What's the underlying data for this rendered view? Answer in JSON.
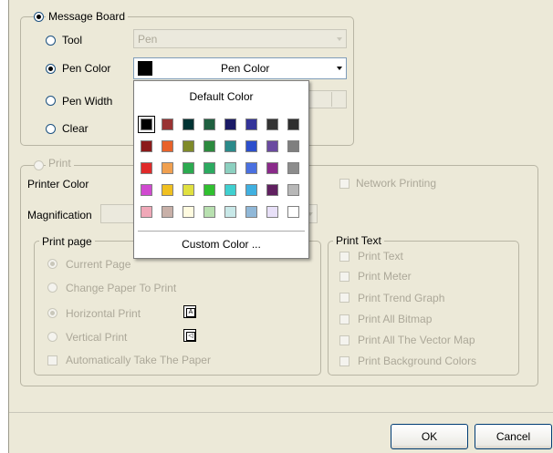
{
  "message_board": {
    "label": "Message Board",
    "tool_label": "Tool",
    "tool_value": "Pen",
    "pen_color_label": "Pen Color",
    "pen_color_value": "Pen Color",
    "pen_width_label": "Pen Width",
    "clear_label": "Clear"
  },
  "color_popup": {
    "default_label": "Default Color",
    "custom_label": "Custom Color ...",
    "swatches": [
      [
        "#000000",
        "#993333",
        "#003333",
        "#336633",
        "#000080",
        "#333399",
        "#333333"
      ],
      [
        "#800000",
        "#ff6600",
        "#808000",
        "#008000",
        "#008080",
        "#0000ff",
        "#666699",
        "#808080"
      ],
      [
        "#ff0000",
        "#ff9900",
        "#99cc00",
        "#339966",
        "#33cccc",
        "#3366ff",
        "#800080",
        "#999999"
      ],
      [
        "#ff00ff",
        "#ffcc00",
        "#ffff00",
        "#00ff00",
        "#00ffff",
        "#00ccff",
        "#993366",
        "#c0c0c0"
      ],
      [
        "#ff99cc",
        "#ffcc99",
        "#ffff99",
        "#ccffcc",
        "#ccffff",
        "#99ccff",
        "#cc99ff",
        "#ffffff"
      ]
    ],
    "colors": {
      "r0": [
        "#000000",
        "#993333",
        "#003333",
        "#1f6040",
        "#1a1a66",
        "#333399",
        "#333333",
        "#2e2e2e"
      ],
      "r1": [
        "#8b1a1a",
        "#e8622a",
        "#7f8a2a",
        "#2c8a3e",
        "#2b8a8a",
        "#2c4ecc",
        "#6a4aa0",
        "#7f7f7f"
      ],
      "r2": [
        "#e02a2a",
        "#f0a050",
        "#2caa50",
        "#2caa60",
        "#8cd0c0",
        "#4a70e0",
        "#8a2a8a",
        "#8c8c8c"
      ],
      "r3": [
        "#d04ad0",
        "#f0c020",
        "#e0e040",
        "#30c030",
        "#40d0d0",
        "#40b0e0",
        "#602060",
        "#b8b8b8"
      ],
      "r4": [
        "#f0a8b8",
        "#c8b0a8",
        "#fffbe0",
        "#b8e0b0",
        "#c8e8e8",
        "#90b8d8",
        "#e8e0f8",
        "#ffffff"
      ]
    }
  },
  "print": {
    "label": "Print",
    "printer_color_label": "Printer Color",
    "magnification_label": "Magnification",
    "network_printing_label": "Network Printing"
  },
  "print_page": {
    "label": "Print page",
    "current_page": "Current Page",
    "change_paper": "Change Paper To Print",
    "horizontal": "Horizontal Print",
    "vertical": "Vertical Print",
    "auto_take": "Automatically Take The Paper"
  },
  "print_text": {
    "label": "Print Text",
    "items": [
      "Print Text",
      "Print Meter",
      "Print Trend Graph",
      "Print All Bitmap",
      "Print All The Vector Map",
      "Print Background Colors"
    ]
  },
  "buttons": {
    "ok": "OK",
    "cancel": "Cancel"
  }
}
